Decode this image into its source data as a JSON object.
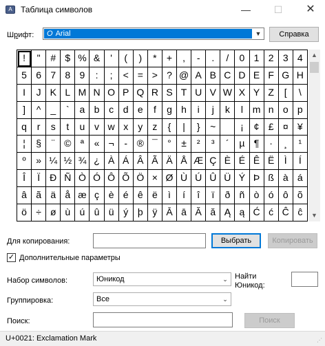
{
  "window": {
    "title": "Таблица символов",
    "icon": "charmap-app-icon",
    "minimize": "—",
    "maximize": "☐",
    "close": "✕"
  },
  "font_row": {
    "label_prefix": "Ш",
    "label_rest": "рифт:",
    "label_u": "р",
    "label_before": "Ш",
    "label_after": "ифт:",
    "font_icon": "O",
    "font_value": "Arial",
    "help_button": "Справка"
  },
  "grid": {
    "rows": [
      [
        "!",
        "\"",
        "#",
        "$",
        "%",
        "&",
        "'",
        "(",
        ")",
        "*",
        "+",
        ",",
        "-",
        ".",
        "/",
        "0",
        "1"
      ],
      [
        "5",
        "6",
        "7",
        "8",
        "9",
        ":",
        ";",
        "<",
        "=",
        ">",
        "?",
        "@",
        "A",
        "B",
        "C",
        "D",
        "E"
      ],
      [
        "I",
        "J",
        "K",
        "L",
        "M",
        "N",
        "O",
        "P",
        "Q",
        "R",
        "S",
        "T",
        "U",
        "V",
        "W",
        "X",
        "Y"
      ],
      [
        "]",
        "^",
        "_",
        "`",
        "a",
        "b",
        "c",
        "d",
        "e",
        "f",
        "g",
        "h",
        "i",
        "j",
        "k",
        "l",
        "m"
      ],
      [
        "q",
        "r",
        "s",
        "t",
        "u",
        "v",
        "w",
        "x",
        "y",
        "z",
        "{",
        "|",
        "}",
        "~",
        " ",
        "¡",
        "¢"
      ],
      [
        "¦",
        "§",
        "¨",
        "©",
        "ª",
        "«",
        "¬",
        "-",
        "®",
        "¯",
        "°",
        "±",
        "²",
        "³",
        "´",
        "µ",
        "¶"
      ],
      [
        "º",
        "»",
        "¼",
        "½",
        "¾",
        "¿",
        "À",
        "Á",
        "Â",
        "Ã",
        "Ä",
        "Å",
        "Æ",
        "Ç",
        "È",
        "É",
        "Ê"
      ],
      [
        "Î",
        "Ï",
        "Ð",
        "Ñ",
        "Ò",
        "Ó",
        "Ô",
        "Õ",
        "Ö",
        "×",
        "Ø",
        "Ù",
        "Ú",
        "Û",
        "Ü",
        "Ý",
        "Þ"
      ],
      [
        "â",
        "ã",
        "ä",
        "å",
        "æ",
        "ç",
        "è",
        "é",
        "ê",
        "ë",
        "ì",
        "í",
        "î",
        "ï",
        "ð",
        "ñ",
        "ò"
      ],
      [
        "ö",
        "÷",
        "ø",
        "ù",
        "ú",
        "û",
        "ü",
        "ý",
        "þ",
        "ÿ",
        "Ā",
        "ā",
        "Ă",
        "ă",
        "Ą",
        "ą",
        "Ć"
      ]
    ],
    "visible_rows": [
      [
        "!",
        "\"",
        "#",
        "$",
        "%",
        "&",
        "'",
        "(",
        ")",
        "*",
        "+",
        ",",
        "-",
        ".",
        "/",
        "0",
        "1",
        "2",
        "3",
        "4"
      ],
      [
        "5",
        "6",
        "7",
        "8",
        "9",
        ":",
        ";",
        "<",
        "=",
        ">",
        "?",
        "@",
        "A",
        "B",
        "C",
        "D",
        "E",
        "F",
        "G",
        "H"
      ],
      [
        "I",
        "J",
        "K",
        "L",
        "M",
        "N",
        "O",
        "P",
        "Q",
        "R",
        "S",
        "T",
        "U",
        "V",
        "W",
        "X",
        "Y",
        "Z",
        "[",
        "\\"
      ],
      [
        "]",
        "^",
        "_",
        "`",
        "a",
        "b",
        "c",
        "d",
        "e",
        "f",
        "g",
        "h",
        "i",
        "j",
        "k",
        "l",
        "m",
        "n",
        "o",
        "p"
      ],
      [
        "q",
        "r",
        "s",
        "t",
        "u",
        "v",
        "w",
        "x",
        "y",
        "z",
        "{",
        "|",
        "}",
        "~",
        " ",
        "¡",
        "¢",
        "£",
        "¤",
        "¥"
      ],
      [
        "¦",
        "§",
        "¨",
        "©",
        "ª",
        "«",
        "¬",
        "-",
        "®",
        "¯",
        "°",
        "±",
        "²",
        "³",
        "´",
        "µ",
        "¶",
        "·",
        "¸",
        "¹"
      ],
      [
        "º",
        "»",
        "¼",
        "½",
        "¾",
        "¿",
        "À",
        "Á",
        "Â",
        "Ã",
        "Ä",
        "Å",
        "Æ",
        "Ç",
        "È",
        "É",
        "Ê",
        "Ë",
        "Ì",
        "Í"
      ],
      [
        "Î",
        "Ï",
        "Ð",
        "Ñ",
        "Ò",
        "Ó",
        "Ô",
        "Õ",
        "Ö",
        "×",
        "Ø",
        "Ù",
        "Ú",
        "Û",
        "Ü",
        "Ý",
        "Þ",
        "ß",
        "à",
        "á"
      ],
      [
        "â",
        "ã",
        "ä",
        "å",
        "æ",
        "ç",
        "è",
        "é",
        "ê",
        "ë",
        "ì",
        "í",
        "î",
        "ï",
        "ð",
        "ñ",
        "ò",
        "ó",
        "ô",
        "õ"
      ],
      [
        "ö",
        "÷",
        "ø",
        "ù",
        "ú",
        "û",
        "ü",
        "ý",
        "þ",
        "ÿ",
        "Ā",
        "ā",
        "Ă",
        "ă",
        "Ą",
        "ą",
        "Ć",
        "ć",
        "Ĉ",
        "ĉ"
      ]
    ],
    "selected": "!"
  },
  "copy_row": {
    "label": "Для копирования:",
    "value": "",
    "select_button": "Выбрать",
    "copy_button": "Копировать"
  },
  "advanced": {
    "checked": true,
    "check_mark": "✓",
    "label": "Дополнительные параметры"
  },
  "charset": {
    "label": "Набор символов:",
    "value": "Юникод",
    "find_label_1": "Найти",
    "find_label_2": "Юникод:",
    "find_value": ""
  },
  "grouping": {
    "label": "Группировка:",
    "value": "Все"
  },
  "search": {
    "label": "Поиск:",
    "value": "",
    "button": "Поиск"
  },
  "status": {
    "text": "U+0021: Exclamation Mark"
  },
  "icons": {
    "dropdown": "chevron-down-icon",
    "scroll_up": "chevron-up-icon",
    "scroll_down": "chevron-down-icon",
    "check": "check-icon",
    "grip": "resize-grip-icon"
  },
  "colors": {
    "selection": "#0078d7",
    "button": "#e1e1e1",
    "disabled_button": "#cccccc"
  }
}
